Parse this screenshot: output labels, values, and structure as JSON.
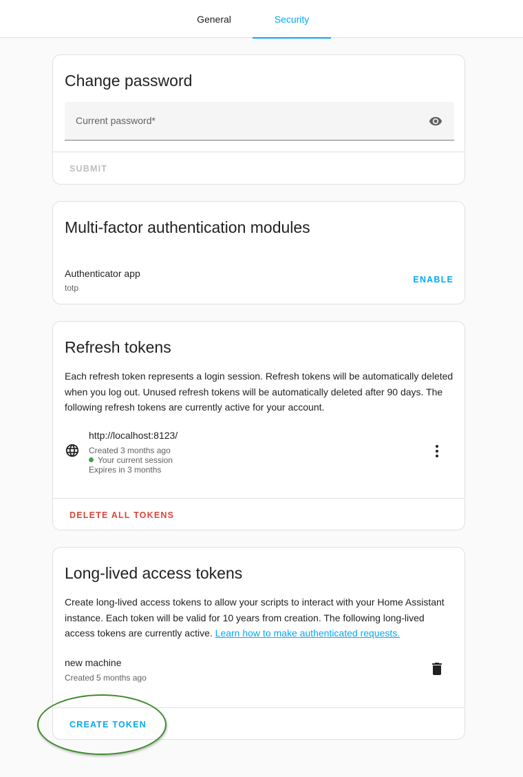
{
  "tabs": [
    {
      "label": "General",
      "active": false
    },
    {
      "label": "Security",
      "active": true
    }
  ],
  "change_password": {
    "title": "Change password",
    "field_label": "Current password*",
    "field_icon": "eye-icon",
    "submit_label": "SUBMIT"
  },
  "mfa": {
    "title": "Multi-factor authentication modules",
    "modules": [
      {
        "name": "Authenticator app",
        "id": "totp",
        "action_label": "ENABLE"
      }
    ]
  },
  "refresh_tokens": {
    "title": "Refresh tokens",
    "description": "Each refresh token represents a login session. Refresh tokens will be automatically deleted when you log out. Unused refresh tokens will be automatically deleted after 90 days. The following refresh tokens are currently active for your account.",
    "tokens": [
      {
        "client": "http://localhost:8123/",
        "created": "Created 3 months ago",
        "session": "Your current session",
        "expires": "Expires in 3 months",
        "icon": "globe-icon",
        "menu_icon": "dots-vertical-icon"
      }
    ],
    "delete_all_label": "DELETE ALL TOKENS"
  },
  "long_lived": {
    "title": "Long-lived access tokens",
    "description_before_link": "Create long-lived access tokens to allow your scripts to interact with your Home Assistant instance. Each token will be valid for 10 years from creation. The following long-lived access tokens are currently active. ",
    "link_text": "Learn how to make authenticated requests.",
    "tokens": [
      {
        "name": "new machine",
        "created": "Created 5 months ago",
        "icon": "trash-icon"
      }
    ],
    "create_label": "CREATE TOKEN"
  },
  "colors": {
    "accent": "#03a9f4",
    "danger": "#db4437",
    "disabled": "#bdbdbd",
    "status_ok": "#43a047",
    "highlight": "#3b8a2c"
  }
}
